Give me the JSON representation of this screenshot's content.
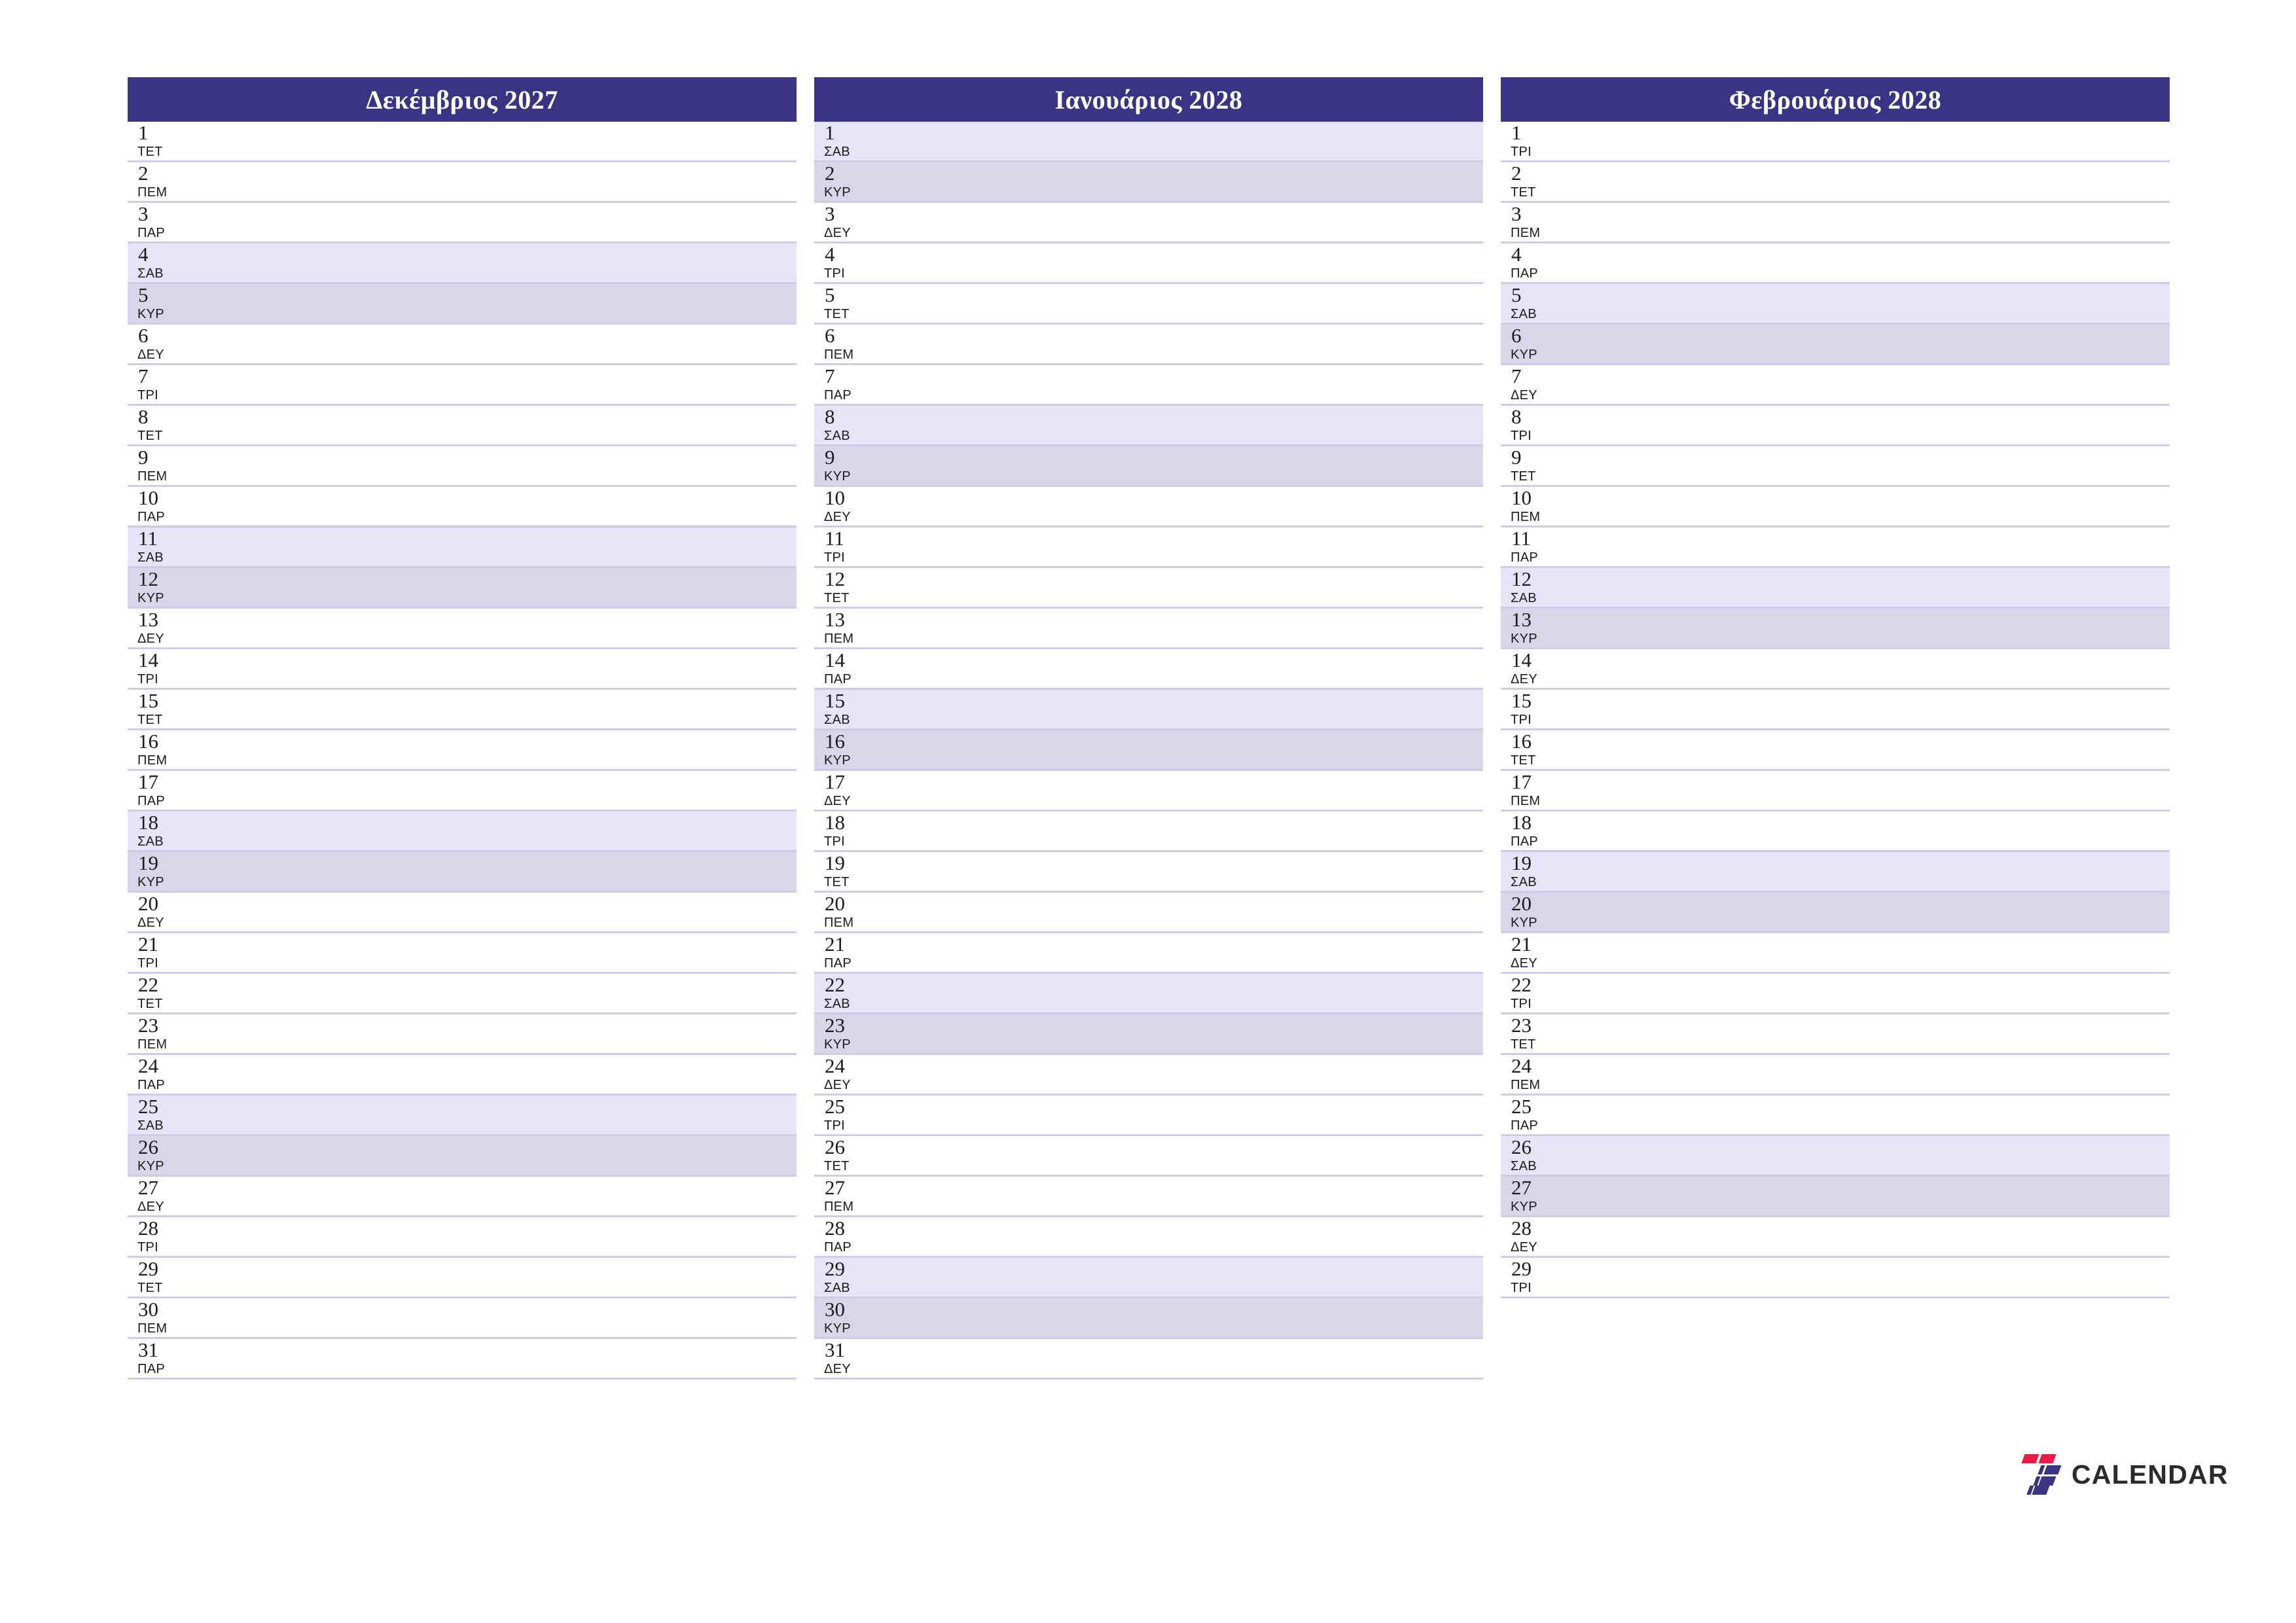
{
  "brand": {
    "logo_icon": "seven-calendar-logo-icon",
    "name": "CALENDAR",
    "accent_red": "#ed1944",
    "accent_blue": "#3a3285"
  },
  "theme": {
    "header_bg": "#3a3285",
    "header_text": "#ffffff",
    "saturday_bg": "#e5e5f7",
    "sunday_bg": "#d9d6e9",
    "row_divider": "#cdcce4",
    "page_bg": "#ffffff"
  },
  "months": [
    {
      "title": "Δεκέμβριος 2027",
      "days": [
        {
          "num": "1",
          "abbr": "ΤΕΤ",
          "type": "weekday"
        },
        {
          "num": "2",
          "abbr": "ΠΕΜ",
          "type": "weekday"
        },
        {
          "num": "3",
          "abbr": "ΠΑΡ",
          "type": "weekday"
        },
        {
          "num": "4",
          "abbr": "ΣΑΒ",
          "type": "sat"
        },
        {
          "num": "5",
          "abbr": "ΚΥΡ",
          "type": "sun"
        },
        {
          "num": "6",
          "abbr": "ΔΕΥ",
          "type": "weekday"
        },
        {
          "num": "7",
          "abbr": "ΤΡΙ",
          "type": "weekday"
        },
        {
          "num": "8",
          "abbr": "ΤΕΤ",
          "type": "weekday"
        },
        {
          "num": "9",
          "abbr": "ΠΕΜ",
          "type": "weekday"
        },
        {
          "num": "10",
          "abbr": "ΠΑΡ",
          "type": "weekday"
        },
        {
          "num": "11",
          "abbr": "ΣΑΒ",
          "type": "sat"
        },
        {
          "num": "12",
          "abbr": "ΚΥΡ",
          "type": "sun"
        },
        {
          "num": "13",
          "abbr": "ΔΕΥ",
          "type": "weekday"
        },
        {
          "num": "14",
          "abbr": "ΤΡΙ",
          "type": "weekday"
        },
        {
          "num": "15",
          "abbr": "ΤΕΤ",
          "type": "weekday"
        },
        {
          "num": "16",
          "abbr": "ΠΕΜ",
          "type": "weekday"
        },
        {
          "num": "17",
          "abbr": "ΠΑΡ",
          "type": "weekday"
        },
        {
          "num": "18",
          "abbr": "ΣΑΒ",
          "type": "sat"
        },
        {
          "num": "19",
          "abbr": "ΚΥΡ",
          "type": "sun"
        },
        {
          "num": "20",
          "abbr": "ΔΕΥ",
          "type": "weekday"
        },
        {
          "num": "21",
          "abbr": "ΤΡΙ",
          "type": "weekday"
        },
        {
          "num": "22",
          "abbr": "ΤΕΤ",
          "type": "weekday"
        },
        {
          "num": "23",
          "abbr": "ΠΕΜ",
          "type": "weekday"
        },
        {
          "num": "24",
          "abbr": "ΠΑΡ",
          "type": "weekday"
        },
        {
          "num": "25",
          "abbr": "ΣΑΒ",
          "type": "sat"
        },
        {
          "num": "26",
          "abbr": "ΚΥΡ",
          "type": "sun"
        },
        {
          "num": "27",
          "abbr": "ΔΕΥ",
          "type": "weekday"
        },
        {
          "num": "28",
          "abbr": "ΤΡΙ",
          "type": "weekday"
        },
        {
          "num": "29",
          "abbr": "ΤΕΤ",
          "type": "weekday"
        },
        {
          "num": "30",
          "abbr": "ΠΕΜ",
          "type": "weekday"
        },
        {
          "num": "31",
          "abbr": "ΠΑΡ",
          "type": "weekday"
        }
      ]
    },
    {
      "title": "Ιανουάριος 2028",
      "days": [
        {
          "num": "1",
          "abbr": "ΣΑΒ",
          "type": "sat"
        },
        {
          "num": "2",
          "abbr": "ΚΥΡ",
          "type": "sun"
        },
        {
          "num": "3",
          "abbr": "ΔΕΥ",
          "type": "weekday"
        },
        {
          "num": "4",
          "abbr": "ΤΡΙ",
          "type": "weekday"
        },
        {
          "num": "5",
          "abbr": "ΤΕΤ",
          "type": "weekday"
        },
        {
          "num": "6",
          "abbr": "ΠΕΜ",
          "type": "weekday"
        },
        {
          "num": "7",
          "abbr": "ΠΑΡ",
          "type": "weekday"
        },
        {
          "num": "8",
          "abbr": "ΣΑΒ",
          "type": "sat"
        },
        {
          "num": "9",
          "abbr": "ΚΥΡ",
          "type": "sun"
        },
        {
          "num": "10",
          "abbr": "ΔΕΥ",
          "type": "weekday"
        },
        {
          "num": "11",
          "abbr": "ΤΡΙ",
          "type": "weekday"
        },
        {
          "num": "12",
          "abbr": "ΤΕΤ",
          "type": "weekday"
        },
        {
          "num": "13",
          "abbr": "ΠΕΜ",
          "type": "weekday"
        },
        {
          "num": "14",
          "abbr": "ΠΑΡ",
          "type": "weekday"
        },
        {
          "num": "15",
          "abbr": "ΣΑΒ",
          "type": "sat"
        },
        {
          "num": "16",
          "abbr": "ΚΥΡ",
          "type": "sun"
        },
        {
          "num": "17",
          "abbr": "ΔΕΥ",
          "type": "weekday"
        },
        {
          "num": "18",
          "abbr": "ΤΡΙ",
          "type": "weekday"
        },
        {
          "num": "19",
          "abbr": "ΤΕΤ",
          "type": "weekday"
        },
        {
          "num": "20",
          "abbr": "ΠΕΜ",
          "type": "weekday"
        },
        {
          "num": "21",
          "abbr": "ΠΑΡ",
          "type": "weekday"
        },
        {
          "num": "22",
          "abbr": "ΣΑΒ",
          "type": "sat"
        },
        {
          "num": "23",
          "abbr": "ΚΥΡ",
          "type": "sun"
        },
        {
          "num": "24",
          "abbr": "ΔΕΥ",
          "type": "weekday"
        },
        {
          "num": "25",
          "abbr": "ΤΡΙ",
          "type": "weekday"
        },
        {
          "num": "26",
          "abbr": "ΤΕΤ",
          "type": "weekday"
        },
        {
          "num": "27",
          "abbr": "ΠΕΜ",
          "type": "weekday"
        },
        {
          "num": "28",
          "abbr": "ΠΑΡ",
          "type": "weekday"
        },
        {
          "num": "29",
          "abbr": "ΣΑΒ",
          "type": "sat"
        },
        {
          "num": "30",
          "abbr": "ΚΥΡ",
          "type": "sun"
        },
        {
          "num": "31",
          "abbr": "ΔΕΥ",
          "type": "weekday"
        }
      ]
    },
    {
      "title": "Φεβρουάριος 2028",
      "days": [
        {
          "num": "1",
          "abbr": "ΤΡΙ",
          "type": "weekday"
        },
        {
          "num": "2",
          "abbr": "ΤΕΤ",
          "type": "weekday"
        },
        {
          "num": "3",
          "abbr": "ΠΕΜ",
          "type": "weekday"
        },
        {
          "num": "4",
          "abbr": "ΠΑΡ",
          "type": "weekday"
        },
        {
          "num": "5",
          "abbr": "ΣΑΒ",
          "type": "sat"
        },
        {
          "num": "6",
          "abbr": "ΚΥΡ",
          "type": "sun"
        },
        {
          "num": "7",
          "abbr": "ΔΕΥ",
          "type": "weekday"
        },
        {
          "num": "8",
          "abbr": "ΤΡΙ",
          "type": "weekday"
        },
        {
          "num": "9",
          "abbr": "ΤΕΤ",
          "type": "weekday"
        },
        {
          "num": "10",
          "abbr": "ΠΕΜ",
          "type": "weekday"
        },
        {
          "num": "11",
          "abbr": "ΠΑΡ",
          "type": "weekday"
        },
        {
          "num": "12",
          "abbr": "ΣΑΒ",
          "type": "sat"
        },
        {
          "num": "13",
          "abbr": "ΚΥΡ",
          "type": "sun"
        },
        {
          "num": "14",
          "abbr": "ΔΕΥ",
          "type": "weekday"
        },
        {
          "num": "15",
          "abbr": "ΤΡΙ",
          "type": "weekday"
        },
        {
          "num": "16",
          "abbr": "ΤΕΤ",
          "type": "weekday"
        },
        {
          "num": "17",
          "abbr": "ΠΕΜ",
          "type": "weekday"
        },
        {
          "num": "18",
          "abbr": "ΠΑΡ",
          "type": "weekday"
        },
        {
          "num": "19",
          "abbr": "ΣΑΒ",
          "type": "sat"
        },
        {
          "num": "20",
          "abbr": "ΚΥΡ",
          "type": "sun"
        },
        {
          "num": "21",
          "abbr": "ΔΕΥ",
          "type": "weekday"
        },
        {
          "num": "22",
          "abbr": "ΤΡΙ",
          "type": "weekday"
        },
        {
          "num": "23",
          "abbr": "ΤΕΤ",
          "type": "weekday"
        },
        {
          "num": "24",
          "abbr": "ΠΕΜ",
          "type": "weekday"
        },
        {
          "num": "25",
          "abbr": "ΠΑΡ",
          "type": "weekday"
        },
        {
          "num": "26",
          "abbr": "ΣΑΒ",
          "type": "sat"
        },
        {
          "num": "27",
          "abbr": "ΚΥΡ",
          "type": "sun"
        },
        {
          "num": "28",
          "abbr": "ΔΕΥ",
          "type": "weekday"
        },
        {
          "num": "29",
          "abbr": "ΤΡΙ",
          "type": "weekday"
        }
      ]
    }
  ]
}
